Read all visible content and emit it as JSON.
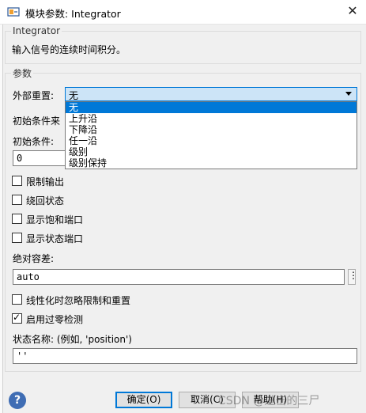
{
  "window": {
    "title": "模块参数: Integrator",
    "app_icon": "simulink-block-icon",
    "close_icon": "close-icon"
  },
  "block_group": {
    "title": "Integrator",
    "description": "输入信号的连续时间积分。"
  },
  "params_group": {
    "title": "参数",
    "external_reset": {
      "label": "外部重置:",
      "value": "无",
      "options": [
        "无",
        "上升沿",
        "下降沿",
        "任一沿",
        "级别",
        "级别保持"
      ],
      "selected_index": 0
    },
    "initial_condition_source": {
      "label": "初始条件来"
    },
    "initial_condition": {
      "label": "初始条件:",
      "value": "0"
    },
    "checkboxes": [
      {
        "label": "限制输出",
        "checked": false
      },
      {
        "label": "绕回状态",
        "checked": false
      },
      {
        "label": "显示饱和端口",
        "checked": false
      },
      {
        "label": "显示状态端口",
        "checked": false
      }
    ],
    "absolute_tolerance": {
      "label": "绝对容差:",
      "value": "auto",
      "more_button": "⋮"
    },
    "checkboxes2": [
      {
        "label": "线性化时忽略限制和重置",
        "checked": false
      },
      {
        "label": "启用过零检测",
        "checked": true
      }
    ],
    "state_name": {
      "label": "状态名称: (例如, 'position')",
      "value": "''"
    }
  },
  "footer": {
    "help_icon": "help-icon",
    "help_glyph": "?",
    "ok_label": "确定(O)",
    "cancel_label": "取消(C)",
    "help_label": "帮助(H)",
    "watermark": "CSDN @进击的三尸"
  }
}
